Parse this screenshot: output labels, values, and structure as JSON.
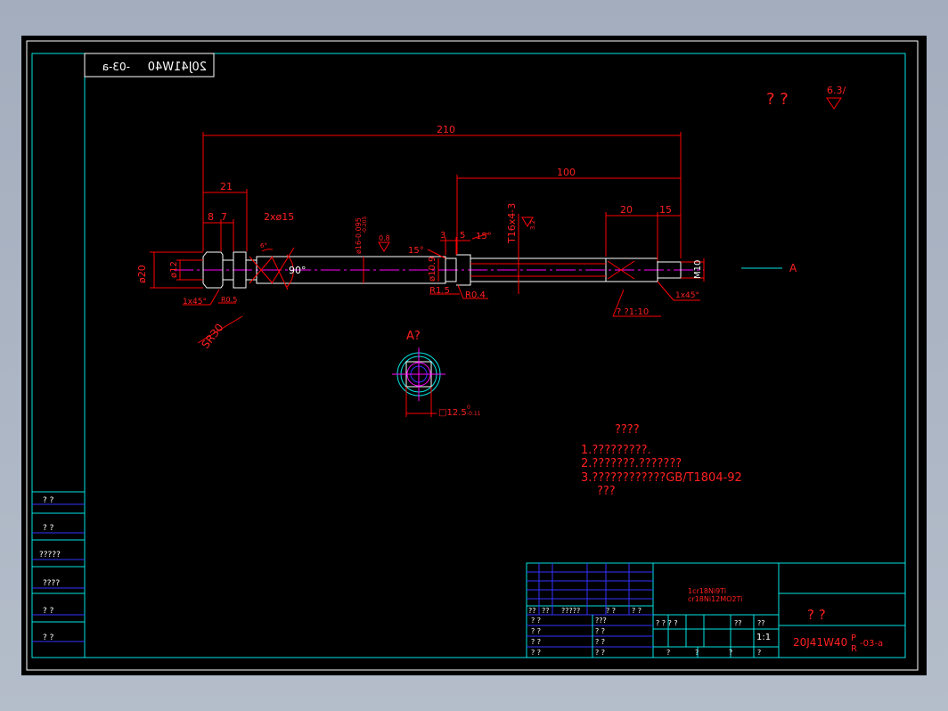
{
  "drawing": {
    "mirrored_code": "20J41W40",
    "mirrored_code_tail": "-03-a",
    "mirrored_code_sup": "P",
    "roughness_symbols": "? ?",
    "roughness_value": "6.3/",
    "section_label": "A?",
    "arrow_label": "A",
    "dimensions": {
      "d210": "210",
      "d100": "100",
      "d21": "21",
      "d8": "8",
      "d7": "7",
      "d2x15": "2xø15",
      "d20": "20",
      "d15": "15",
      "dia20": "ø20",
      "dia12": "ø12",
      "dia16": "ø16-0.095",
      "dia16b": "-0.205",
      "dia10_9": "ø10.9",
      "r1_5": "R1.5",
      "r0_4": "R0.4",
      "r0_5": "R0.5",
      "chamfer1": "1x45°",
      "chamfer2": "1x45°",
      "sr30": "SR30",
      "ang90": "90°",
      "ang15a": "15°",
      "ang15b": "15°",
      "ang6": "6°",
      "d3": "3",
      "d5": "5",
      "thread": "T16x4-3",
      "rough32": "3.2",
      "rough08": "0.8",
      "m10": "M10",
      "taper": "?  ?1:10",
      "square": "12.5",
      "square_tol": "-0.11",
      "square_tol_top": "0"
    },
    "notes": {
      "title": "????",
      "line1": "1.?????????.",
      "line2": "2.???????.???????",
      "line3": "3.????????????GB/T1804-92",
      "line4": "???"
    }
  },
  "left_table": [
    "?   ?",
    "?   ?",
    "?????",
    "????",
    "?   ?",
    "?   ?"
  ],
  "title_block": {
    "material1": "1cr18Ni9Ti",
    "material2": "cr18Ni12MO2Ti",
    "name": "?    ?",
    "code": "20J41W40",
    "code_sup": "P",
    "code_sub": "R",
    "code_tail": "-03-a",
    "scale": "1:1",
    "sig_row": [
      "??",
      "??",
      "?????",
      "? ?",
      "? ?"
    ],
    "rows_left": [
      "? ?",
      "? ?",
      "? ?",
      "? ?"
    ],
    "rows_mid": [
      "???",
      "? ?",
      "? ?",
      "? ?"
    ],
    "mid_row": [
      "? ? ? ?",
      "??",
      "??"
    ],
    "bottom_row": [
      "?",
      "?",
      "?",
      "?"
    ]
  }
}
